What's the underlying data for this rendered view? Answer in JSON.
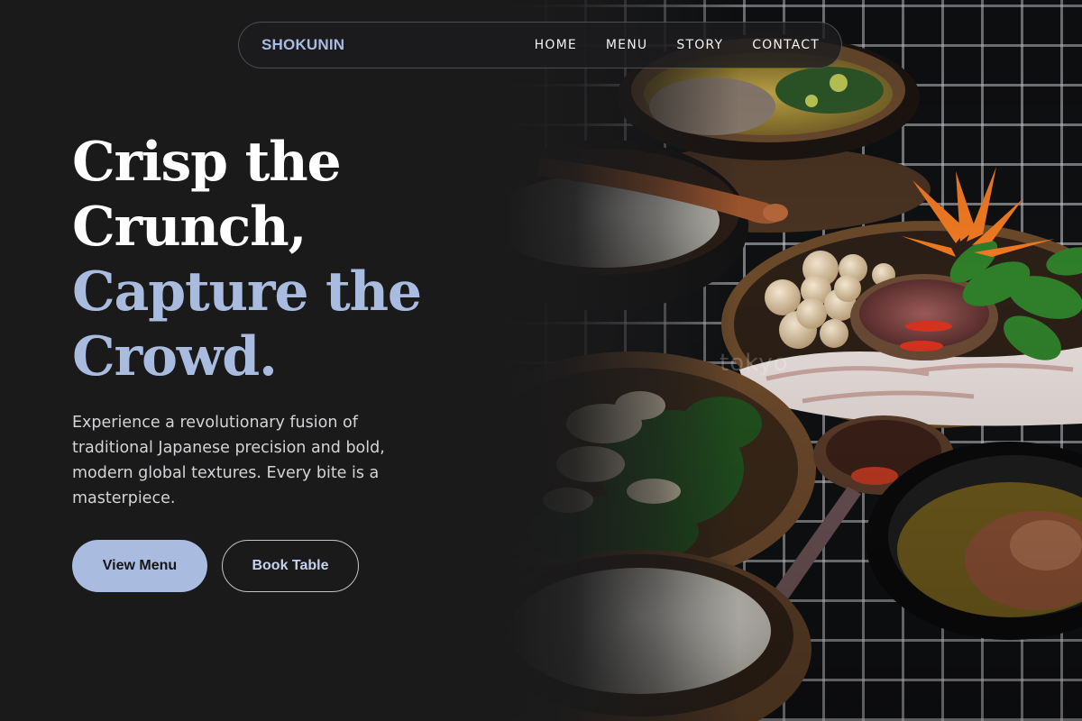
{
  "brand": "SHOKUNIN",
  "nav": {
    "links": [
      {
        "label": "HOME"
      },
      {
        "label": "MENU"
      },
      {
        "label": "STORY"
      },
      {
        "label": "CONTACT"
      }
    ]
  },
  "hero": {
    "headline_lines": [
      "Crisp the",
      "Crunch,",
      "Capture the",
      "Crowd."
    ],
    "subtext": "Experience a revolutionary fusion of traditional Japanese precision and bold, modern global textures. Every bite is a masterpiece.",
    "primary_button": "View Menu",
    "secondary_button": "Book Table",
    "image_watermark": "tokyo"
  },
  "colors": {
    "background": "#1a1a1b",
    "accent": "#a9bcdf",
    "text": "#ffffff",
    "muted_text": "#d4d4d6"
  }
}
